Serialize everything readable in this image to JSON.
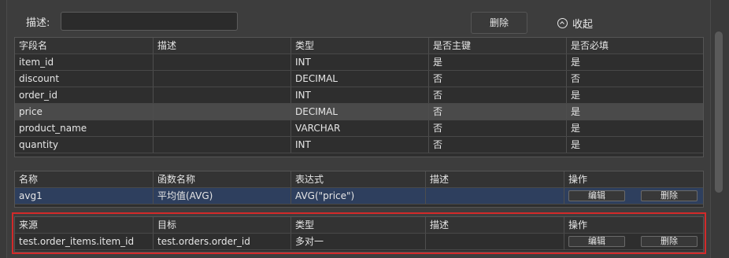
{
  "form": {
    "description_label": "描述:",
    "description_value": "",
    "delete_label": "删除",
    "collapse_label": "收起"
  },
  "fields_table": {
    "headers": [
      "字段名",
      "描述",
      "类型",
      "是否主键",
      "是否必填"
    ],
    "rows": [
      [
        "item_id",
        "",
        "INT",
        "是",
        "是"
      ],
      [
        "discount",
        "",
        "DECIMAL",
        "否",
        "否"
      ],
      [
        "order_id",
        "",
        "INT",
        "否",
        "是"
      ],
      [
        "price",
        "",
        "DECIMAL",
        "否",
        "是"
      ],
      [
        "product_name",
        "",
        "VARCHAR",
        "否",
        "是"
      ],
      [
        "quantity",
        "",
        "INT",
        "否",
        "是"
      ]
    ]
  },
  "functions_table": {
    "headers": [
      "名称",
      "函数名称",
      "表达式",
      "描述",
      "操作"
    ],
    "rows": [
      [
        "avg1",
        "平均值(AVG)",
        "AVG(\"price\")",
        ""
      ]
    ],
    "edit_label": "编辑",
    "delete_label": "删除"
  },
  "relations_table": {
    "headers": [
      "来源",
      "目标",
      "类型",
      "描述",
      "操作"
    ],
    "rows": [
      [
        "test.order_items.item_id",
        "test.orders.order_id",
        "多对一",
        ""
      ]
    ],
    "edit_label": "编辑",
    "delete_label": "删除"
  },
  "colors": {
    "highlight_box": "#d32a2a",
    "selected_row": "#2e3f5e"
  }
}
